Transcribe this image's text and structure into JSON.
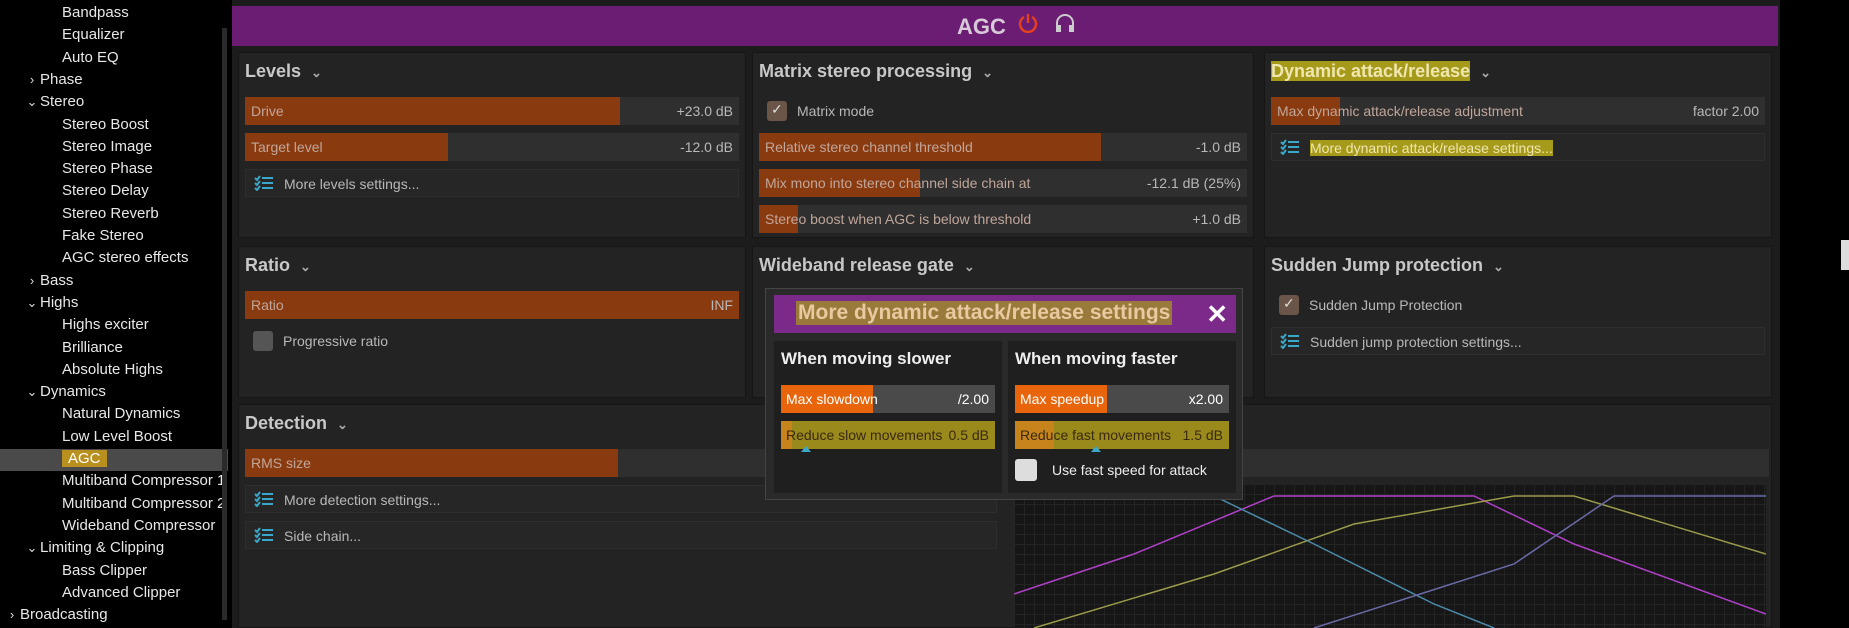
{
  "sidebar": {
    "items": [
      {
        "label": "Bandpass",
        "chev": ""
      },
      {
        "label": "Equalizer",
        "chev": ""
      },
      {
        "label": "Auto EQ",
        "chev": ""
      },
      {
        "label": "Phase",
        "chev": "›"
      },
      {
        "label": "Stereo",
        "chev": "⌄"
      },
      {
        "label": "Stereo Boost",
        "chev": ""
      },
      {
        "label": "Stereo Image",
        "chev": ""
      },
      {
        "label": "Stereo Phase",
        "chev": ""
      },
      {
        "label": "Stereo Delay",
        "chev": ""
      },
      {
        "label": "Stereo Reverb",
        "chev": ""
      },
      {
        "label": "Fake Stereo",
        "chev": ""
      },
      {
        "label": "AGC stereo effects",
        "chev": ""
      },
      {
        "label": "Bass",
        "chev": "›"
      },
      {
        "label": "Highs",
        "chev": "⌄"
      },
      {
        "label": "Highs exciter",
        "chev": ""
      },
      {
        "label": "Brilliance",
        "chev": ""
      },
      {
        "label": "Absolute Highs",
        "chev": ""
      },
      {
        "label": "Dynamics",
        "chev": "⌄"
      },
      {
        "label": "Natural Dynamics",
        "chev": ""
      },
      {
        "label": "Low Level Boost",
        "chev": ""
      },
      {
        "label": "AGC",
        "chev": ""
      },
      {
        "label": "Multiband Compressor 1",
        "chev": ""
      },
      {
        "label": "Multiband Compressor 2",
        "chev": ""
      },
      {
        "label": "Wideband Compressor",
        "chev": ""
      },
      {
        "label": "Limiting & Clipping",
        "chev": "⌄"
      },
      {
        "label": "Bass Clipper",
        "chev": ""
      },
      {
        "label": "Advanced Clipper",
        "chev": ""
      },
      {
        "label": "Broadcasting",
        "chev": "›"
      }
    ]
  },
  "header": {
    "title": "AGC"
  },
  "levels": {
    "title": "Levels",
    "drive": {
      "label": "Drive",
      "value": "+23.0 dB",
      "fill": 0.76
    },
    "target": {
      "label": "Target level",
      "value": "-12.0 dB",
      "fill": 0.41
    },
    "more": "More levels settings..."
  },
  "matrix": {
    "title": "Matrix stereo processing",
    "matrix_mode": "Matrix mode",
    "rel": {
      "label": "Relative stereo channel threshold",
      "value": "-1.0 dB",
      "fill": 0.7
    },
    "mix": {
      "label": "Mix mono into stereo channel side chain at",
      "value": "-12.1 dB (25%)",
      "fill": 0.33
    },
    "boost": {
      "label": "Stereo boost when AGC is below threshold",
      "value": "+1.0 dB",
      "fill": 0.08
    }
  },
  "dynamic": {
    "title": "Dynamic attack/release",
    "max": {
      "label": "Max dynamic attack/release adjustment",
      "value": "factor 2.00",
      "fill": 0.14
    },
    "more": "More dynamic attack/release settings..."
  },
  "ratio": {
    "title": "Ratio",
    "ratio": {
      "label": "Ratio",
      "value": "INF",
      "fill": 1.0
    },
    "progressive": "Progressive ratio"
  },
  "wideband": {
    "title": "Wideband release gate"
  },
  "sudden": {
    "title": "Sudden Jump protection",
    "chk": "Sudden Jump Protection",
    "more": "Sudden jump protection settings..."
  },
  "detection": {
    "title": "Detection",
    "rms": {
      "label": "RMS size",
      "fill": 0.48
    },
    "more": "More detection settings...",
    "side": "Side chain..."
  },
  "dialog": {
    "title": "More dynamic attack/release settings",
    "close": "✕",
    "slower": {
      "heading": "When moving slower",
      "max": {
        "label": "Max slowdown",
        "value": "/2.00",
        "fill": 0.43
      },
      "reduce": {
        "label": "Reduce slow movements",
        "value": "0.5 dB",
        "fill": 0.05
      }
    },
    "faster": {
      "heading": "When moving faster",
      "max": {
        "label": "Max speedup",
        "value": "x2.00",
        "fill": 0.43
      },
      "reduce": {
        "label": "Reduce fast movements",
        "value": "1.5 dB",
        "fill": 0.18
      },
      "fast_attack": "Use fast speed for attack"
    }
  },
  "colors": {
    "accent": "#6a1d73",
    "orange": "#e8650c",
    "highlight": "#b98f1e"
  }
}
